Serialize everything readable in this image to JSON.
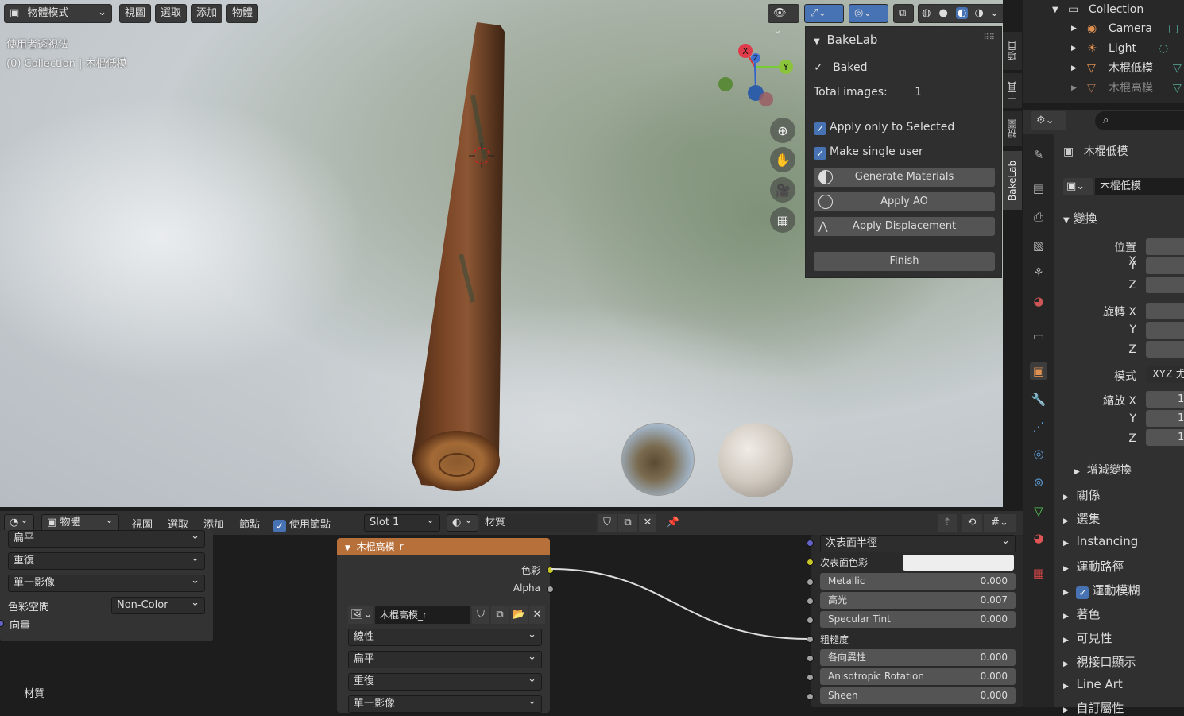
{
  "viewport": {
    "mode": "物體模式",
    "menus": [
      "視圖",
      "選取",
      "添加",
      "物體"
    ],
    "overlay_line1": "使用者透視法",
    "overlay_line2": "(0) Collection | 木棍低模",
    "gizmo": {
      "x": "X",
      "y": "Y",
      "z": "Z"
    }
  },
  "bakelab": {
    "title": "BakeLab",
    "baked": "Baked",
    "total_images_label": "Total images:",
    "total_images_value": "1",
    "apply_only_selected": "Apply only to Selected",
    "make_single_user": "Make single user",
    "generate_materials": "Generate Materials",
    "apply_ao": "Apply AO",
    "apply_displacement": "Apply Displacement",
    "finish": "Finish"
  },
  "side_tabs": [
    "項目",
    "工具",
    "視圖",
    "BakeLab"
  ],
  "outliner": {
    "collection": "Collection",
    "items": [
      "Camera",
      "Light",
      "木棍低模",
      "木棍高模"
    ]
  },
  "properties": {
    "object_name": "木棍低模",
    "object_field": "木棍低模",
    "transform_title": "變換",
    "location": [
      "位置 X",
      "Y",
      "Z"
    ],
    "rotation": [
      "旋轉 X",
      "Y",
      "Z"
    ],
    "mode_label": "模式",
    "mode_value": "XYZ 尤",
    "scale": [
      "縮放 X",
      "Y",
      "Z"
    ],
    "scale_values": [
      "1",
      "1",
      "1"
    ],
    "delta_transform": "增減變換",
    "sections": [
      "關係",
      "選集",
      "Instancing",
      "運動路徑",
      "運動模糊",
      "著色",
      "可見性",
      "視接口顯示",
      "Line Art",
      "自訂屬性"
    ]
  },
  "node_header": {
    "editor": "物體",
    "menus": [
      "視圖",
      "選取",
      "添加",
      "節點"
    ],
    "use_nodes": "使用節點",
    "slot": "Slot 1",
    "material": "材質"
  },
  "left_node": {
    "dropdowns": [
      "扁平",
      "重復",
      "單一影像"
    ],
    "colorspace_label": "色彩空間",
    "colorspace_value": "Non-Color",
    "vector": "向量",
    "material_label": "材質"
  },
  "image_node": {
    "title": "木棍高模_r",
    "out_color": "色彩",
    "out_alpha": "Alpha",
    "image_name": "木棍高模_r",
    "interpolation": "線性",
    "projection": "扁平",
    "extension": "重復",
    "source": "單一影像"
  },
  "bsdf": {
    "subsurface_method": "次表面半徑",
    "subsurface_color": "次表面色彩",
    "fields": [
      {
        "label": "Metallic",
        "value": "0.000"
      },
      {
        "label": "高光",
        "value": "0.007"
      },
      {
        "label": "Specular Tint",
        "value": "0.000"
      },
      {
        "label": "粗糙度",
        "value": ""
      },
      {
        "label": "各向異性",
        "value": "0.000"
      },
      {
        "label": "Anisotropic Rotation",
        "value": "0.000"
      },
      {
        "label": "Sheen",
        "value": "0.000"
      }
    ]
  }
}
